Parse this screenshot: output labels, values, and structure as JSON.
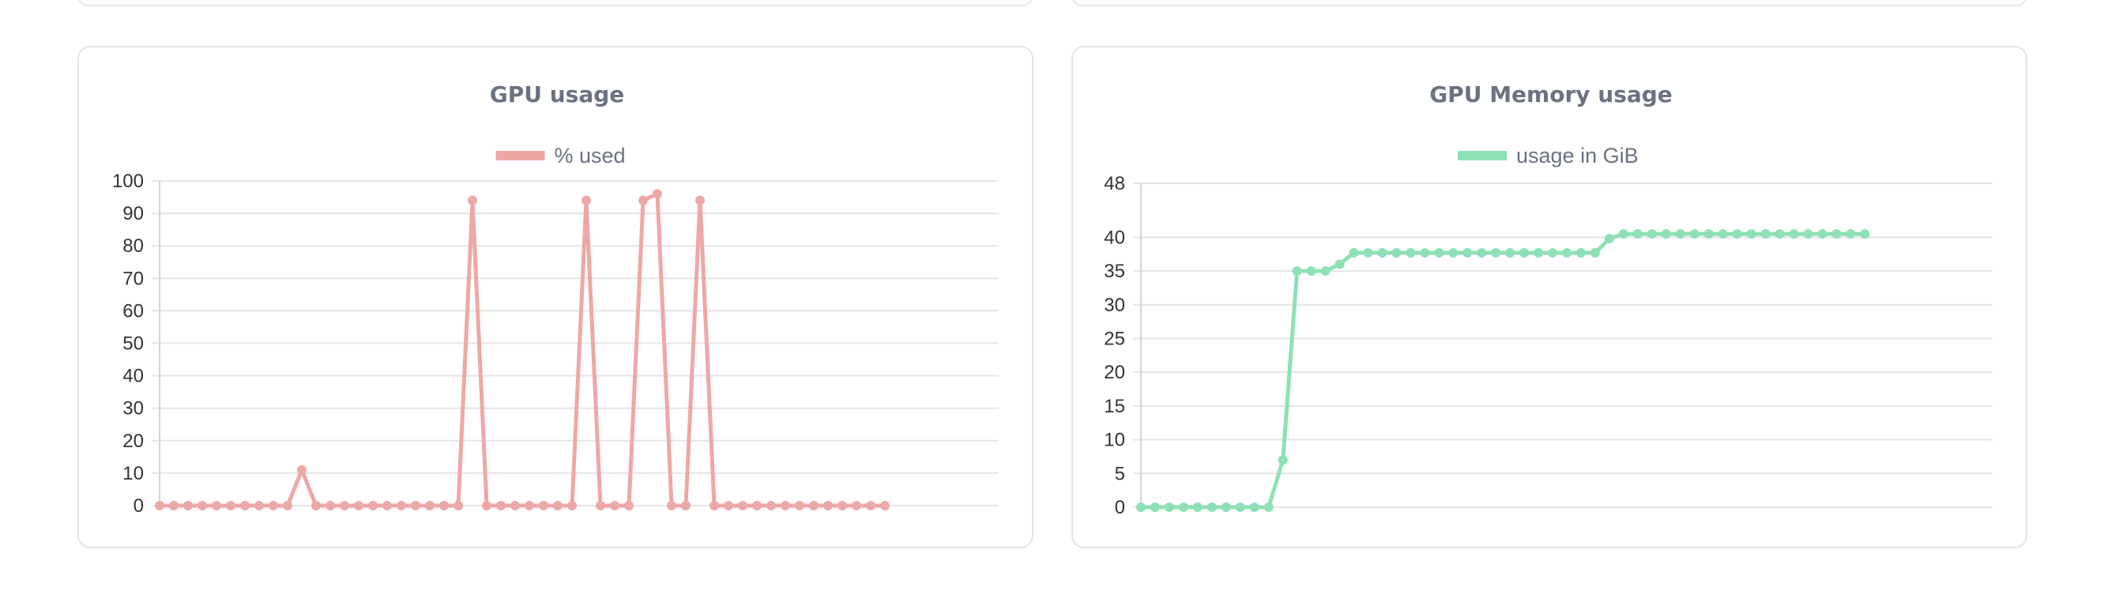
{
  "charts": [
    {
      "type": "line",
      "title": "GPU usage",
      "legend": "% used",
      "color": "#eda8a5",
      "ylim": [
        0,
        100
      ],
      "yticks": [
        0,
        10,
        20,
        30,
        40,
        50,
        60,
        70,
        80,
        90,
        100
      ],
      "x_count": 60,
      "values": [
        0,
        0,
        0,
        0,
        0,
        0,
        0,
        0,
        0,
        0,
        11,
        0,
        0,
        0,
        0,
        0,
        0,
        0,
        0,
        0,
        0,
        0,
        94,
        0,
        0,
        0,
        0,
        0,
        0,
        0,
        94,
        0,
        0,
        0,
        94,
        96,
        0,
        0,
        94,
        0,
        0,
        0,
        0,
        0,
        0,
        0,
        0,
        0,
        0,
        0,
        0,
        0
      ]
    },
    {
      "type": "line",
      "title": "GPU Memory usage",
      "legend": "usage in GiB",
      "color": "#8ee0b5",
      "ylim": [
        0,
        48
      ],
      "yticks": [
        0,
        5,
        10,
        15,
        20,
        25,
        30,
        35,
        40,
        48
      ],
      "x_count": 61,
      "values": [
        0,
        0,
        0,
        0,
        0,
        0,
        0,
        0,
        0,
        0,
        7,
        35,
        35,
        35,
        36,
        37.7,
        37.7,
        37.7,
        37.7,
        37.7,
        37.7,
        37.7,
        37.7,
        37.7,
        37.7,
        37.7,
        37.7,
        37.7,
        37.7,
        37.7,
        37.7,
        37.7,
        37.7,
        39.8,
        40.5,
        40.5,
        40.5,
        40.5,
        40.5,
        40.5,
        40.5,
        40.5,
        40.5,
        40.5,
        40.5,
        40.5,
        40.5,
        40.5,
        40.5,
        40.5,
        40.5,
        40.5
      ]
    }
  ]
}
